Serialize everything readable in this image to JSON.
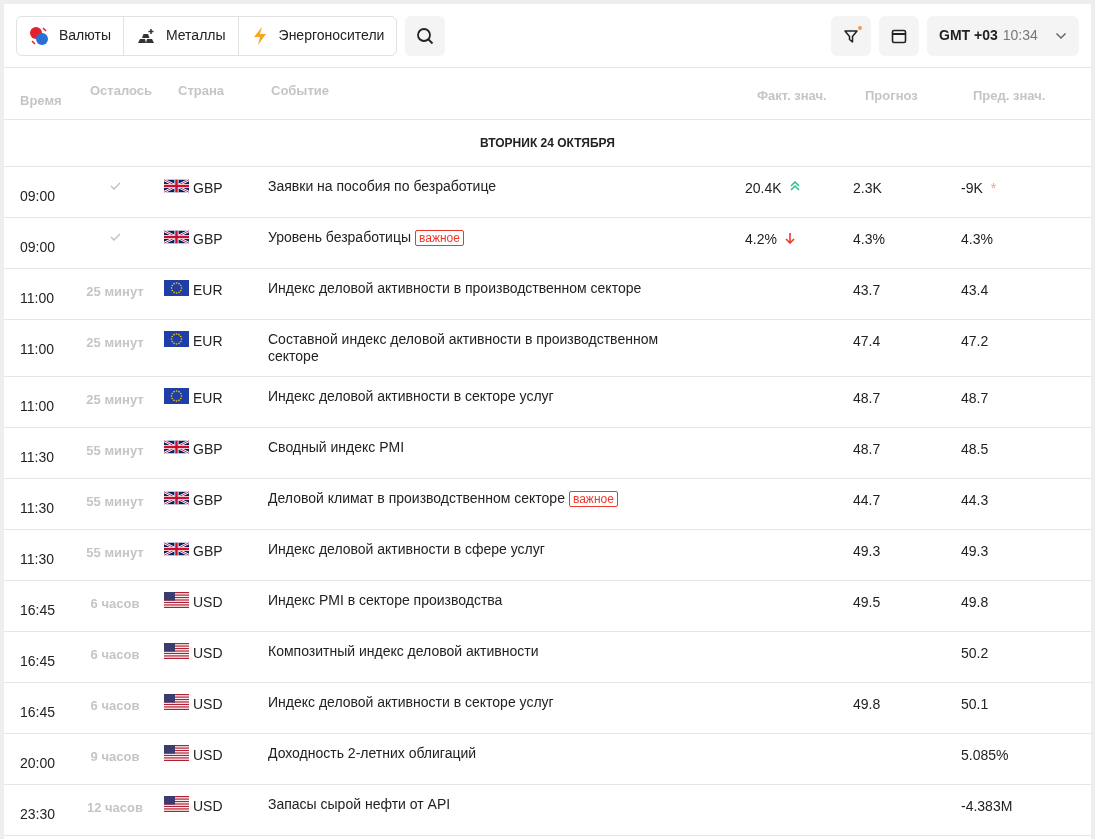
{
  "toolbar": {
    "categories": [
      {
        "label": "Валюты",
        "kind": "currency"
      },
      {
        "label": "Металлы",
        "kind": "metals"
      },
      {
        "label": "Энергоносители",
        "kind": "energy"
      }
    ],
    "filter_active": true,
    "timezone": {
      "label": "GMT +03",
      "time": "10:34"
    }
  },
  "table": {
    "columns": [
      "Время",
      "Осталось",
      "Страна",
      "Событие",
      "Факт. знач.",
      "Прогноз",
      "Пред. знач."
    ],
    "date_heading": "ВТОРНИК 24 ОКТЯБРЯ",
    "rows": [
      {
        "time": "09:00",
        "done": true,
        "flag": {
          "kind": "gb"
        },
        "currency": "GBP",
        "event": "Заявки на пособия по безработице",
        "actual": "20.4K",
        "trend": {
          "kind": "strong_up"
        },
        "forecast": "2.3K",
        "previous": "-9K",
        "revised_mark": "*"
      },
      {
        "time": "09:00",
        "done": true,
        "flag": {
          "kind": "gb"
        },
        "currency": "GBP",
        "event": "Уровень безработицы",
        "badge": "важное",
        "actual": "4.2%",
        "trend": {
          "kind": "down"
        },
        "forecast": "4.3%",
        "previous": "4.3%"
      },
      {
        "time": "11:00",
        "done": false,
        "remaining": "25 минут",
        "flag": {
          "kind": "eu"
        },
        "currency": "EUR",
        "event": "Индекс деловой активности в производственном секторе",
        "forecast": "43.7",
        "previous": "43.4"
      },
      {
        "time": "11:00",
        "done": false,
        "remaining": "25 минут",
        "flag": {
          "kind": "eu"
        },
        "currency": "EUR",
        "event": "Составной индекс деловой активности в производственном секторе",
        "forecast": "47.4",
        "previous": "47.2"
      },
      {
        "time": "11:00",
        "done": false,
        "remaining": "25 минут",
        "flag": {
          "kind": "eu"
        },
        "currency": "EUR",
        "event": "Индекс деловой активности в секторе услуг",
        "forecast": "48.7",
        "previous": "48.7"
      },
      {
        "time": "11:30",
        "done": false,
        "remaining": "55 минут",
        "flag": {
          "kind": "gb"
        },
        "currency": "GBP",
        "event": "Сводный индекс PMI",
        "forecast": "48.7",
        "previous": "48.5"
      },
      {
        "time": "11:30",
        "done": false,
        "remaining": "55 минут",
        "flag": {
          "kind": "gb"
        },
        "currency": "GBP",
        "event": "Деловой климат в производственном секторе",
        "badge": "важное",
        "forecast": "44.7",
        "previous": "44.3"
      },
      {
        "time": "11:30",
        "done": false,
        "remaining": "55 минут",
        "flag": {
          "kind": "gb"
        },
        "currency": "GBP",
        "event": "Индекс деловой активности в сфере услуг",
        "forecast": "49.3",
        "previous": "49.3"
      },
      {
        "time": "16:45",
        "done": false,
        "remaining": "6 часов",
        "flag": {
          "kind": "us"
        },
        "currency": "USD",
        "event": "Индекс PMI в секторе производства",
        "forecast": "49.5",
        "previous": "49.8"
      },
      {
        "time": "16:45",
        "done": false,
        "remaining": "6 часов",
        "flag": {
          "kind": "us"
        },
        "currency": "USD",
        "event": "Композитный индекс деловой активности",
        "previous": "50.2"
      },
      {
        "time": "16:45",
        "done": false,
        "remaining": "6 часов",
        "flag": {
          "kind": "us"
        },
        "currency": "USD",
        "event": "Индекс деловой активности в секторе услуг",
        "forecast": "49.8",
        "previous": "50.1"
      },
      {
        "time": "20:00",
        "done": false,
        "remaining": "9 часов",
        "flag": {
          "kind": "us"
        },
        "currency": "USD",
        "event": "Доходность 2-летних облигаций",
        "previous": "5.085%"
      },
      {
        "time": "23:30",
        "done": false,
        "remaining": "12 часов",
        "flag": {
          "kind": "us"
        },
        "currency": "USD",
        "event": "Запасы сырой нефти от API",
        "previous": "-4.383M"
      }
    ]
  }
}
